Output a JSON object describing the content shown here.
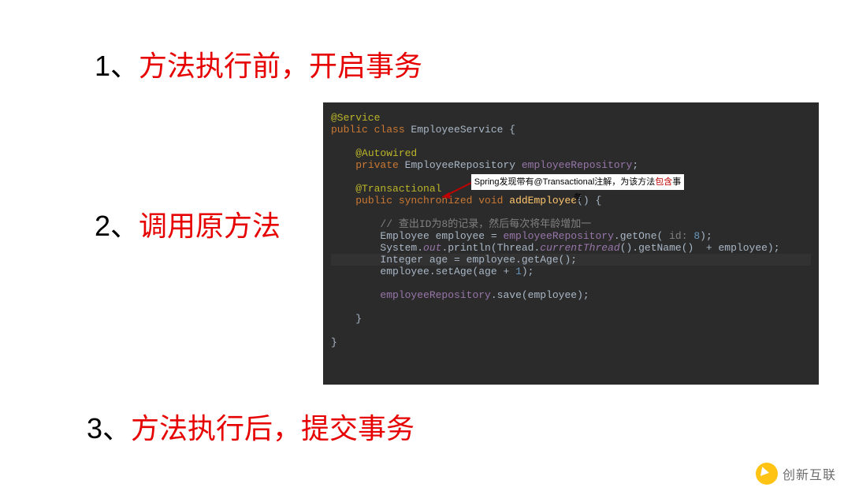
{
  "steps": {
    "s1": {
      "num": "1、",
      "txt": "方法执行前，开启事务"
    },
    "s2": {
      "num": "2、",
      "txt": "调用原方法"
    },
    "s3": {
      "num": "3、",
      "txt": "方法执行后，提交事务"
    }
  },
  "code": {
    "l1_an": "@Service",
    "l2_kw": "public class ",
    "l2_cls": "EmployeeService ",
    "l2_br": "{",
    "l3": "",
    "l4_an": "@Autowired",
    "l5_kw": "private ",
    "l5_type": "EmployeeRepository ",
    "l5_fld": "employeeRepository",
    "l5_semi": ";",
    "l6": "",
    "l7_an": "@Transactional",
    "l8_kw": "public synchronized void ",
    "l8_mth": "addEmployee",
    "l8_rest": "() {",
    "l9": "",
    "l10_cmt": "// 查出ID为8的记录，然后每次将年龄增加一",
    "l11_a": "Employee employee = ",
    "l11_fld": "employeeRepository",
    "l11_b": ".getOne( ",
    "l11_pm": "id: ",
    "l11_nm": "8",
    "l11_c": ");",
    "l12_a": "System.",
    "l12_out": "out",
    "l12_b": ".println(Thread.",
    "l12_ct": "currentThread",
    "l12_c": "().getName()  + employee);",
    "l13": "Integer age = employee.getAge();",
    "l14_a": "employee.setAge(age + ",
    "l14_nm": "1",
    "l14_b": ");",
    "l15": "",
    "l16_fld": "employeeRepository",
    "l16_b": ".save(employee);",
    "l17": "",
    "l18": "}",
    "l19": "",
    "l20": "}"
  },
  "tooltip": {
    "pre": "Spring发现带有@Transactional注解，为该方法",
    "red": "包含",
    "post": "事务"
  },
  "watermark": {
    "text": "创新互联"
  }
}
